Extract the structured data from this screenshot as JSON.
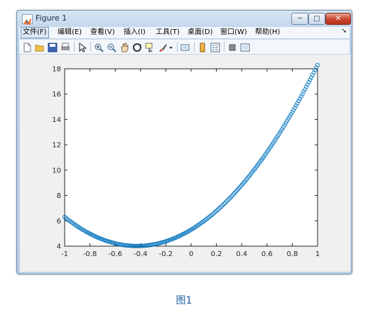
{
  "window": {
    "title": "Figure 1",
    "controls": {
      "minimize": "─",
      "maximize": "□",
      "close": "✕"
    }
  },
  "menu": {
    "items": [
      "文件(F)",
      "编辑(E)",
      "查看(V)",
      "插入(I)",
      "工具(T)",
      "桌面(D)",
      "窗口(W)",
      "帮助(H)"
    ],
    "active_index": 0,
    "overflow_arrow": "➘"
  },
  "toolbar": {
    "icons": [
      "new-figure-icon",
      "open-file-icon",
      "save-icon",
      "print-icon",
      "edit-plot-arrow-icon",
      "zoom-in-icon",
      "zoom-out-icon",
      "pan-hand-icon",
      "rotate-3d-icon",
      "data-cursor-icon",
      "brush-icon",
      "brush-dropdown-icon",
      "link-plot-icon",
      "insert-colorbar-icon",
      "insert-legend-icon",
      "hide-plot-tools-icon",
      "show-plot-tools-icon"
    ]
  },
  "chart_data": {
    "type": "scatter",
    "marker": "open-circle",
    "color": "#0072bd",
    "function": "y = 7x^2 + 6x + 5.3",
    "x_range": [
      -1,
      1
    ],
    "num_points": 201,
    "xlim": [
      -1,
      1
    ],
    "ylim": [
      4,
      18
    ],
    "xticks": [
      "-1",
      "-0.8",
      "-0.6",
      "-0.4",
      "-0.2",
      "0",
      "0.2",
      "0.4",
      "0.6",
      "0.8",
      "1"
    ],
    "yticks": [
      "4",
      "6",
      "8",
      "10",
      "12",
      "14",
      "16",
      "18"
    ],
    "grid": false,
    "title": "",
    "xlabel": "",
    "ylabel": ""
  },
  "caption": "图1"
}
